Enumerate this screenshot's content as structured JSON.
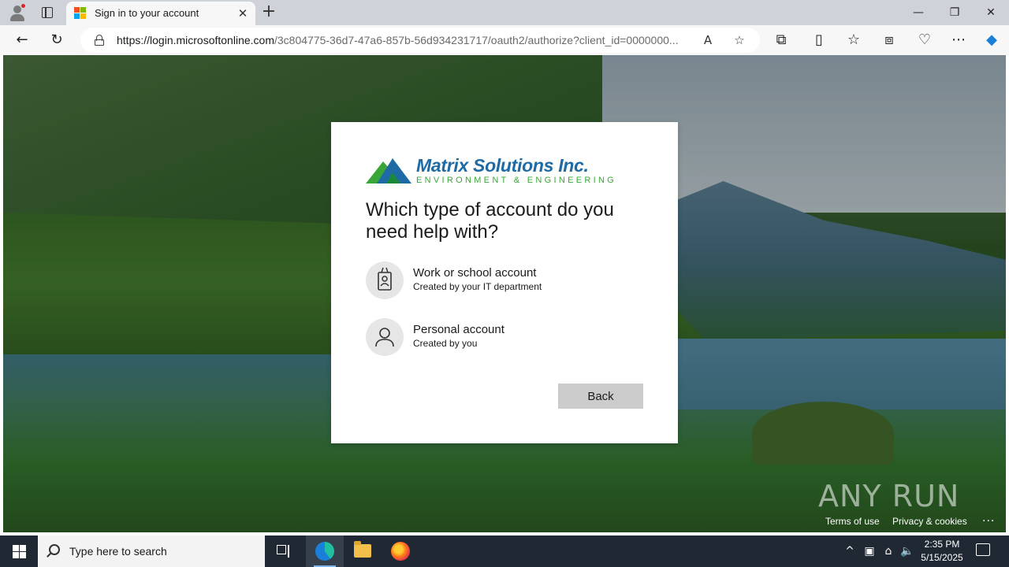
{
  "browser": {
    "tab_title": "Sign in to your account",
    "url_host": "https://login.microsoftonline.com",
    "url_path": "/3c804775-36d7-47a6-857b-56d934231717/oauth2/authorize?client_id=0000000..."
  },
  "card": {
    "brand_name": "Matrix Solutions Inc.",
    "brand_sub": "ENVIRONMENT & ENGINEERING",
    "title": "Which type of account do you need help with?",
    "options": [
      {
        "label": "Work or school account",
        "sub": "Created by your IT department"
      },
      {
        "label": "Personal account",
        "sub": "Created by you"
      }
    ],
    "back_label": "Back"
  },
  "footer": {
    "terms": "Terms of use",
    "privacy": "Privacy & cookies",
    "more": "..."
  },
  "watermark": "ANY RUN",
  "taskbar": {
    "search_placeholder": "Type here to search",
    "time": "2:35 PM",
    "date": "5/15/2025"
  },
  "colors": {
    "brand_blue": "#1d6aa5",
    "brand_green": "#3aa63a",
    "button_gray": "#cccccc"
  }
}
